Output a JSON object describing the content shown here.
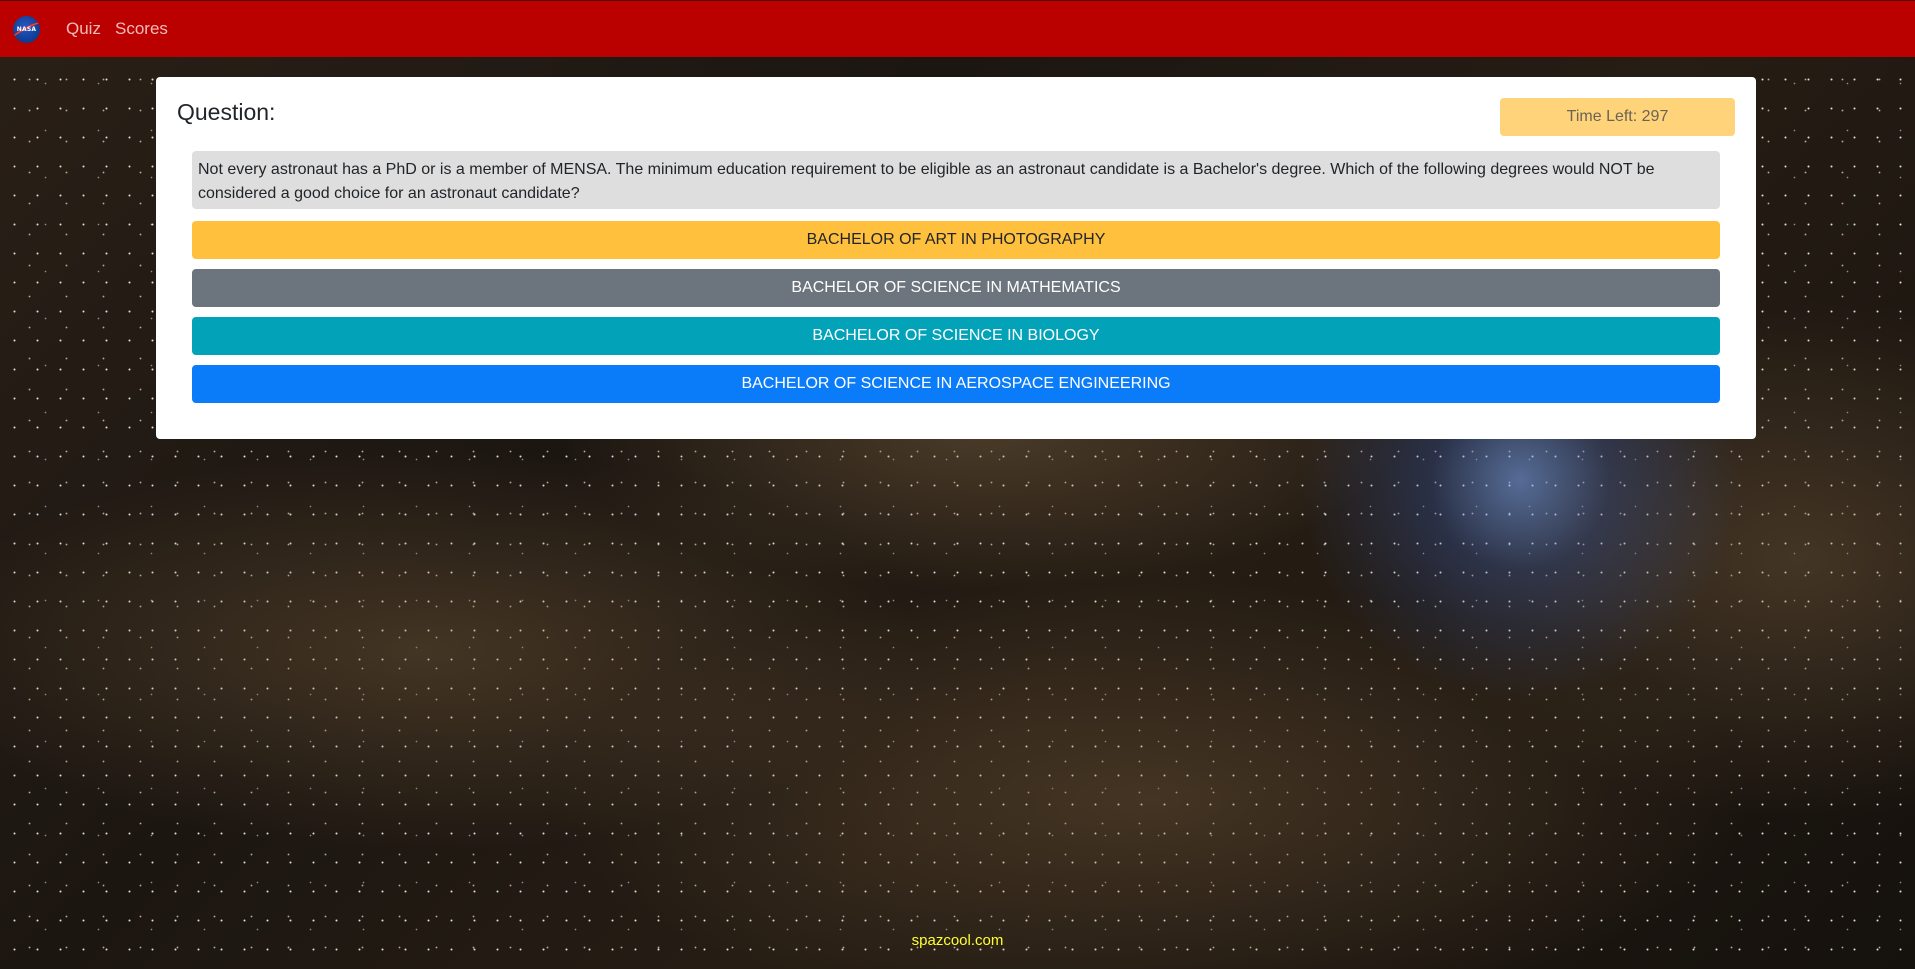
{
  "navbar": {
    "logo_text": "NASA",
    "links": [
      {
        "label": "Quiz"
      },
      {
        "label": "Scores"
      }
    ]
  },
  "quiz": {
    "heading": "Question:",
    "timer_label": "Time Left: 297",
    "question": "Not every astronaut has a PhD or is a member of MENSA. The minimum education requirement to be eligible as an astronaut candidate is a Bachelor's degree. Which of the following degrees would NOT be considered a good choice for an astronaut candidate?",
    "answers": [
      {
        "label": "BACHELOR OF ART IN PHOTOGRAPHY",
        "color": "#ffc03d"
      },
      {
        "label": "BACHELOR OF SCIENCE IN MATHEMATICS",
        "color": "#6c757d"
      },
      {
        "label": "BACHELOR OF SCIENCE IN BIOLOGY",
        "color": "#02a3b8"
      },
      {
        "label": "BACHELOR OF SCIENCE IN AEROSPACE ENGINEERING",
        "color": "#0a7cf9"
      }
    ]
  },
  "footer": {
    "text": "spazcool.com"
  },
  "colors": {
    "navbar": "#bb0000",
    "timer": "#ffd37a",
    "question_bg": "#dedede",
    "footer_text": "#ffff33"
  }
}
